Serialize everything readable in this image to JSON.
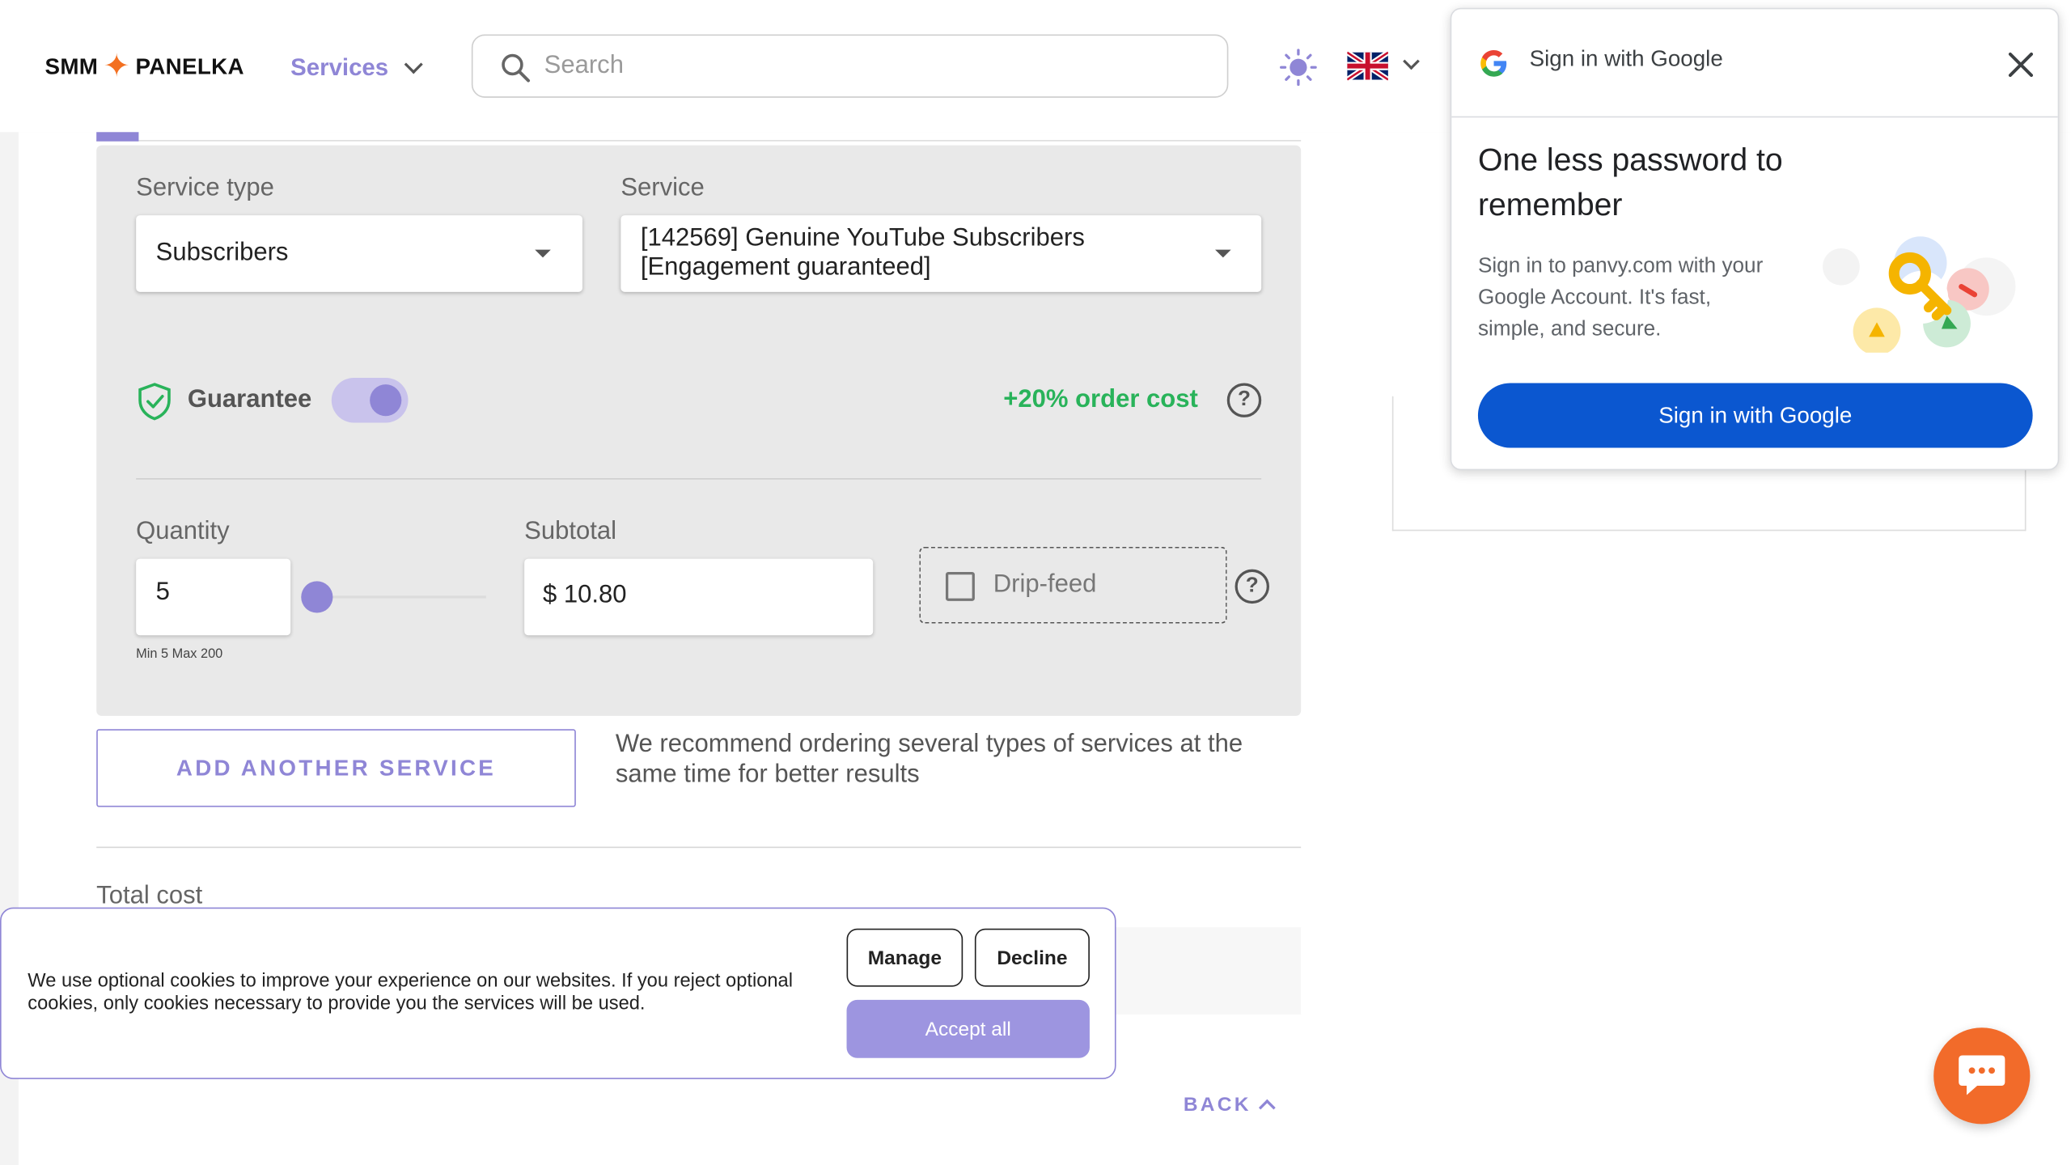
{
  "header": {
    "logo_left": "SMM",
    "logo_right": "PANELKA",
    "nav_services": "Services",
    "search_placeholder": "Search",
    "icons": [
      "search-icon",
      "sun-icon",
      "uk-flag-icon",
      "chevron-down-icon"
    ]
  },
  "form": {
    "service_type_label": "Service type",
    "service_type_value": "Subscribers",
    "service_label": "Service",
    "service_value_line1": "[142569] Genuine YouTube Subscribers",
    "service_value_line2": "[Engagement guaranteed]",
    "guarantee_label": "Guarantee",
    "guarantee_enabled": true,
    "order_cost_note": "+20% order cost",
    "help_glyph": "?",
    "quantity_label": "Quantity",
    "quantity_value": "5",
    "quantity_min": 5,
    "quantity_max": 200,
    "quantity_minmax_text": "Min 5 Max 200",
    "subtotal_label": "Subtotal",
    "subtotal_value": "$ 10.80",
    "dripfeed_label": "Drip-feed",
    "dripfeed_checked": false,
    "add_service_button": "ADD ANOTHER SERVICE",
    "recommend_text": "We recommend ordering several types of services at the same time for better results",
    "total_cost_label": "Total cost",
    "back_label": "BACK"
  },
  "google_popup": {
    "title": "Sign in with Google",
    "headline": "One less password to remember",
    "body": "Sign in to panvy.com with your Google Account. It's fast, simple, and secure.",
    "button": "Sign in with Google"
  },
  "cookie_banner": {
    "text": "We use optional cookies to improve your experience on our websites. If you reject optional cookies, only cookies necessary to provide you the services will be used.",
    "manage": "Manage",
    "decline": "Decline",
    "accept": "Accept all"
  },
  "colors": {
    "accent": "#8f86d6",
    "success": "#29b35a",
    "google_blue": "#0b57d0",
    "chat_orange": "#f26b2a"
  }
}
